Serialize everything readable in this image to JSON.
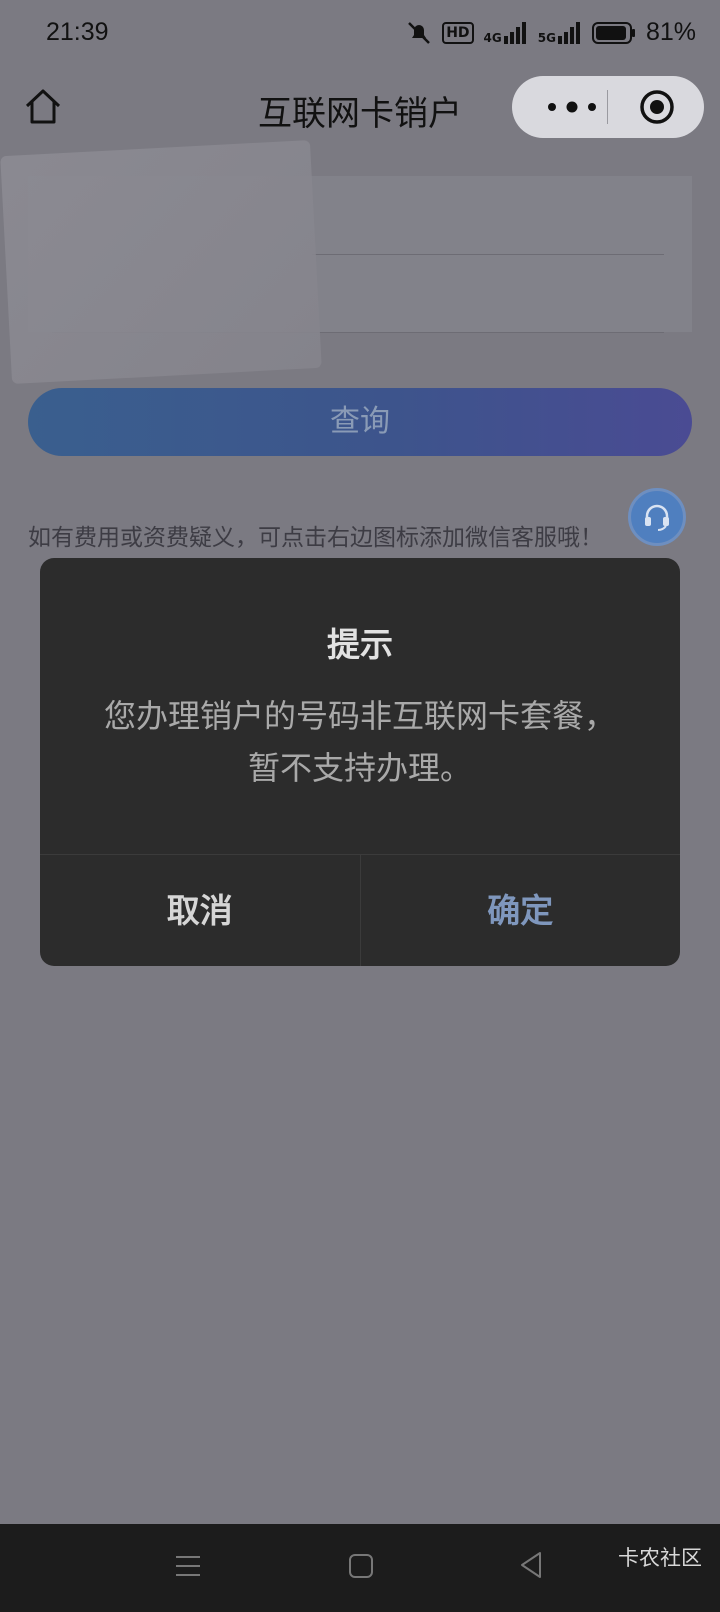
{
  "status_bar": {
    "time": "21:39",
    "battery_percent": "81%",
    "network_1": "4G",
    "network_2": "5G",
    "hd_label": "HD"
  },
  "navbar": {
    "title": "互联网卡销户"
  },
  "form": {
    "query_button": "查询",
    "hint": "如有费用或资费疑义，可点击右边图标添加微信客服哦！"
  },
  "dialog": {
    "title": "提示",
    "message_line1": "您办理销户的号码非互联网卡套餐，",
    "message_line2": "暂不支持办理。",
    "cancel_label": "取消",
    "confirm_label": "确定"
  },
  "watermark": "卡农社区",
  "colors": {
    "dialog_bg": "#2c2c2c",
    "confirm_text": "#7f97bd",
    "query_gradient_start": "#3a5f8e",
    "query_gradient_end": "#4a4b93"
  }
}
